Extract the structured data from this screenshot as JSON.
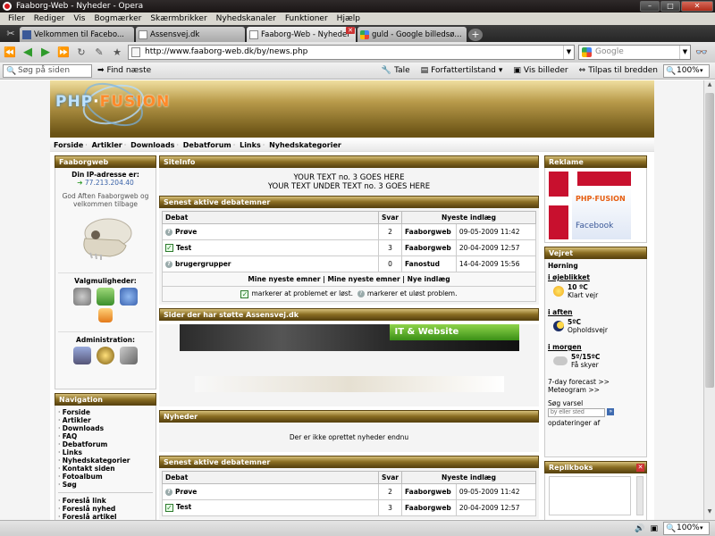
{
  "window": {
    "title": "Faaborg-Web - Nyheder - Opera",
    "controls": [
      "–",
      "□",
      "✕"
    ]
  },
  "menu": [
    "Filer",
    "Rediger",
    "Vis",
    "Bogmærker",
    "Skærmbrikker",
    "Nyhedskanaler",
    "Funktioner",
    "Hjælp"
  ],
  "tabs": [
    {
      "label": "Velkommen til Facebo...",
      "icon": "facebook-icon"
    },
    {
      "label": "Assensvej.dk",
      "icon": "page-icon"
    },
    {
      "label": "Faaborg-Web - Nyheder",
      "icon": "page-icon",
      "active": true
    },
    {
      "label": "guld - Google billedsø...",
      "icon": "google-icon"
    }
  ],
  "address": {
    "url": "http://www.faaborg-web.dk/by/news.php",
    "search_placeholder": "Google"
  },
  "findbar": {
    "search_placeholder": "Søg på siden",
    "find_next": "Find næste",
    "tale": "Tale",
    "author_mode": "Forfattertilstand",
    "show_images": "Vis billeder",
    "fit_width": "Tilpas til bredden",
    "zoom": "100%"
  },
  "status": {
    "zoom": "100%"
  },
  "site": {
    "logo_php": "PHP",
    "logo_fusion": "FUSION",
    "nav": [
      "Forside",
      "Artikler",
      "Downloads",
      "Debatforum",
      "Links",
      "Nyhedskategorier"
    ],
    "left": {
      "box_title": "Faaborgweb",
      "ip_label": "Din IP-adresse er:",
      "ip": "77.213.204.40",
      "greeting": "God Aften Faaborgweb og velkommen tilbage",
      "options_title": "Valgmuligheder:",
      "admin_title": "Administration:",
      "nav_title": "Navigation",
      "nav_items": [
        "Forside",
        "Artikler",
        "Downloads",
        "FAQ",
        "Debatforum",
        "Links",
        "Nyhedskategorier",
        "Kontakt siden",
        "Fotoalbum",
        "Søg"
      ],
      "nav_items2": [
        "Foreslå link",
        "Foreslå nyhed",
        "Foreslå artikel"
      ]
    },
    "center": {
      "siteinfo_title": "SiteInfo",
      "siteinfo_line1": "YOUR TEXT no. 3 GOES HERE",
      "siteinfo_line2": "YOUR TEXT UNDER TEXT no. 3 GOES HERE",
      "debat_title": "Senest aktive debatemner",
      "debat_headers": [
        "Debat",
        "Svar",
        "Nyeste indlæg"
      ],
      "debat_rows": [
        {
          "topic": "Prøve",
          "icon": "question",
          "replies": "2",
          "user": "Faaborgweb",
          "date": "09-05-2009 11:42"
        },
        {
          "topic": "Test",
          "icon": "check",
          "replies": "3",
          "user": "Faaborgweb",
          "date": "20-04-2009 12:57"
        },
        {
          "topic": "brugergrupper",
          "icon": "question",
          "replies": "0",
          "user": "Fanostud",
          "date": "14-04-2009 15:56"
        }
      ],
      "debat_footer": "Mine nyeste emner | Mine nyeste emner | Nye indlæg",
      "legend_solved": "markerer at problemet er løst.",
      "legend_unsolved": "markerer et uløst problem.",
      "support_title": "Sider der har støtte Assensvej.dk",
      "banner_text": "IT & Website",
      "news_title": "Nyheder",
      "no_news": "Der er ikke oprettet nyheder endnu",
      "debat2_title": "Senest aktive debatemner",
      "debat2_rows": [
        {
          "topic": "Prøve",
          "icon": "question",
          "replies": "2",
          "user": "Faaborgweb",
          "date": "09-05-2009 11:42"
        },
        {
          "topic": "Test",
          "icon": "check",
          "replies": "3",
          "user": "Faaborgweb",
          "date": "20-04-2009 12:57"
        }
      ]
    },
    "right": {
      "ad_title": "Reklame",
      "ad_logo": "PHP·FUSION",
      "ad_brand": "Facebook",
      "weather_title": "Vejret",
      "city": "Hørning",
      "now_label": "i øjeblikket",
      "now_temp": "10 ºC",
      "now_desc": "Klart vejr",
      "tonight_label": "i aften",
      "tonight_temp": "5ºC",
      "tonight_desc": "Opholdsvejr",
      "tomorrow_label": "i morgen",
      "tomorrow_temp": "5º/15ºC",
      "tomorrow_desc": "Få skyer",
      "forecast_link": "7-day forecast >>",
      "meteogram_link": "Meteogram >>",
      "search_label": "Søg varsel",
      "search_placeholder": "by eller sted",
      "search_go": "»",
      "updates": "opdateringer af",
      "replik_title": "Replikboks"
    }
  }
}
